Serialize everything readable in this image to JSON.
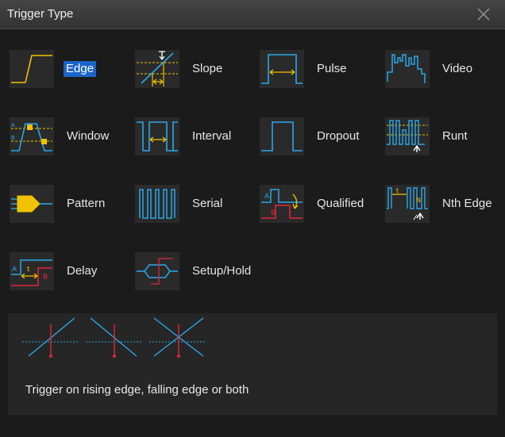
{
  "dialog": {
    "title": "Trigger Type",
    "close_icon": "close-icon",
    "selected": "Edge"
  },
  "trigger_types": [
    {
      "label": "Edge",
      "icon": "edge-trigger-icon",
      "selected": true
    },
    {
      "label": "Slope",
      "icon": "slope-trigger-icon"
    },
    {
      "label": "Pulse",
      "icon": "pulse-trigger-icon"
    },
    {
      "label": "Video",
      "icon": "video-trigger-icon"
    },
    {
      "label": "Window",
      "icon": "window-trigger-icon"
    },
    {
      "label": "Interval",
      "icon": "interval-trigger-icon"
    },
    {
      "label": "Dropout",
      "icon": "dropout-trigger-icon"
    },
    {
      "label": "Runt",
      "icon": "runt-trigger-icon"
    },
    {
      "label": "Pattern",
      "icon": "pattern-trigger-icon"
    },
    {
      "label": "Serial",
      "icon": "serial-trigger-icon"
    },
    {
      "label": "Qualified",
      "icon": "qualified-trigger-icon"
    },
    {
      "label": "Nth Edge",
      "icon": "nth-edge-trigger-icon"
    },
    {
      "label": "Delay",
      "icon": "delay-trigger-icon"
    },
    {
      "label": "Setup/Hold",
      "icon": "setup-hold-trigger-icon"
    }
  ],
  "icon_text": {
    "window_a": "A",
    "window_b": "B",
    "qualified_a": "A",
    "qualified_b": "B",
    "delay_a": "A",
    "delay_t": "t",
    "delay_b": "B",
    "nth_t": "t",
    "nth_n": "N"
  },
  "description": {
    "text": "Trigger on rising edge, falling edge or both",
    "illustration": "rising-falling-both-edges-diagram"
  },
  "colors": {
    "signal": "#2aa7ea",
    "level": "#f2c200",
    "marker": "#e0263a",
    "selected": "#1c64c8"
  }
}
